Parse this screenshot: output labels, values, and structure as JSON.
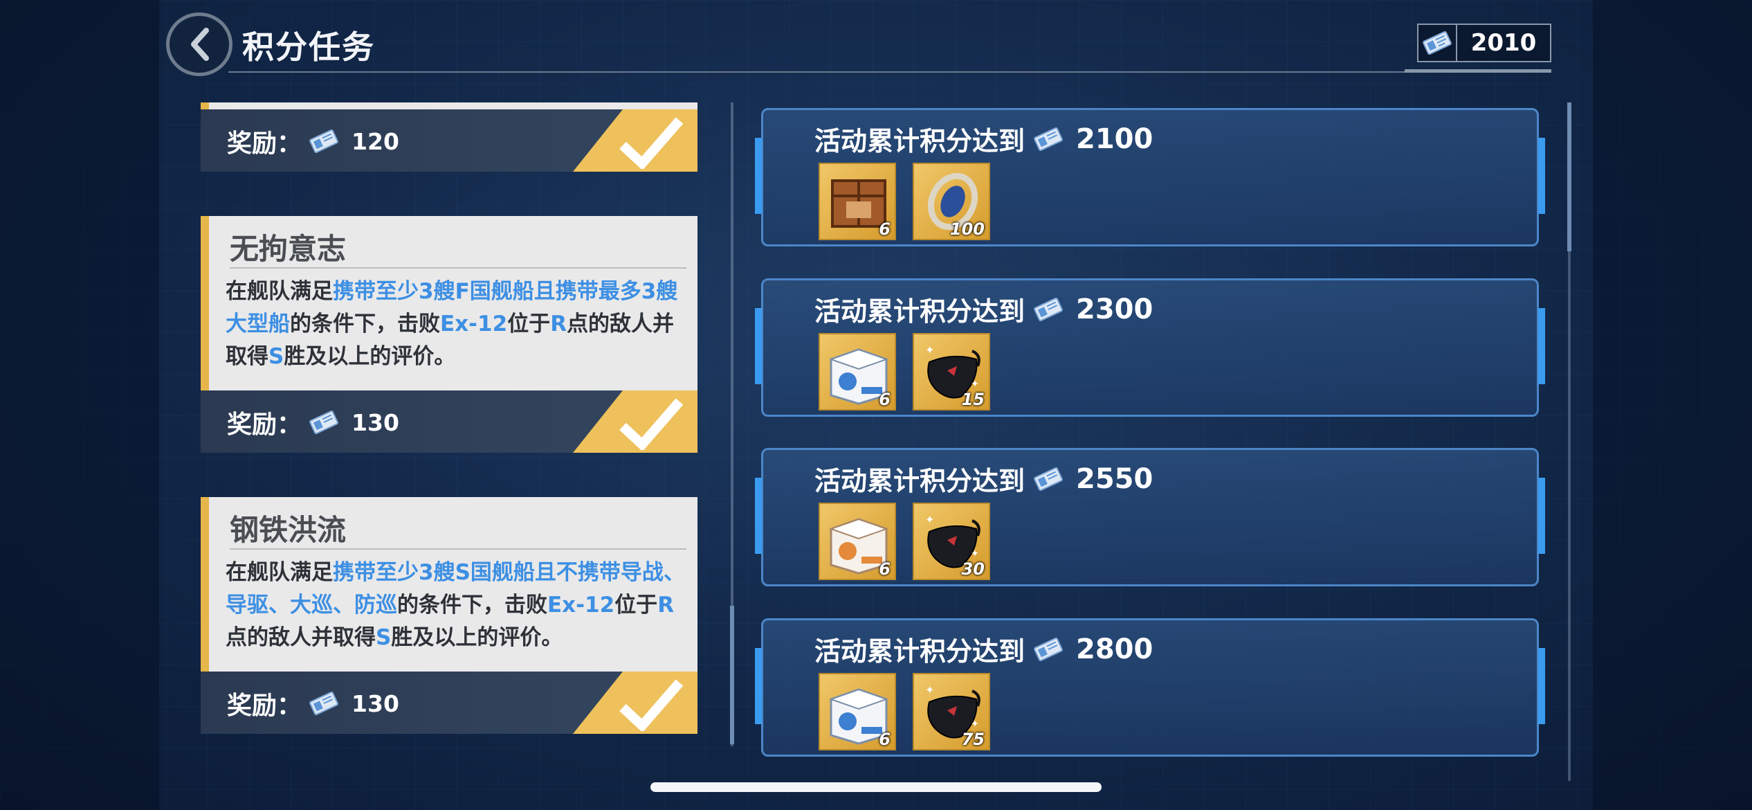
{
  "header": {
    "title": "积分任务",
    "points": "2010"
  },
  "tasks": [
    {
      "name": "",
      "reward_label": "奖励：",
      "reward_value": "120",
      "completed": true
    },
    {
      "name": "无拘意志",
      "desc_parts": [
        {
          "text": "在舰队满足",
          "hl": false
        },
        {
          "text": "携带至少3艘F国舰船且携带最多3艘大型船",
          "hl": true
        },
        {
          "text": "的条件下，击败",
          "hl": false
        },
        {
          "text": "Ex-12",
          "hl": true
        },
        {
          "text": "位于",
          "hl": false
        },
        {
          "text": "R",
          "hl": true
        },
        {
          "text": "点的敌人并取得",
          "hl": false
        },
        {
          "text": "S",
          "hl": true
        },
        {
          "text": "胜及以上的评价。",
          "hl": false
        }
      ],
      "reward_label": "奖励：",
      "reward_value": "130",
      "completed": true
    },
    {
      "name": "钢铁洪流",
      "desc_parts": [
        {
          "text": "在舰队满足",
          "hl": false
        },
        {
          "text": "携带至少3艘S国舰船且不携带导战、导驱、大巡、防巡",
          "hl": true
        },
        {
          "text": "的条件下，击败",
          "hl": false
        },
        {
          "text": "Ex-12",
          "hl": true
        },
        {
          "text": "位于",
          "hl": false
        },
        {
          "text": "R",
          "hl": true
        },
        {
          "text": "点的敌人并取得",
          "hl": false
        },
        {
          "text": "S",
          "hl": true
        },
        {
          "text": "胜及以上的评价。",
          "hl": false
        }
      ],
      "reward_label": "奖励：",
      "reward_value": "130",
      "completed": true
    }
  ],
  "milestones": [
    {
      "label": "活动累计积分达到",
      "target": "2100",
      "items": [
        {
          "icon": "wooden-crate-icon",
          "qty": "6"
        },
        {
          "icon": "ring-token-icon",
          "qty": "100"
        }
      ]
    },
    {
      "label": "活动累计积分达到",
      "target": "2300",
      "items": [
        {
          "icon": "blue-supply-box-icon",
          "qty": "6"
        },
        {
          "icon": "black-pouch-icon",
          "qty": "15"
        }
      ]
    },
    {
      "label": "活动累计积分达到",
      "target": "2550",
      "items": [
        {
          "icon": "orange-supply-box-icon",
          "qty": "6"
        },
        {
          "icon": "black-pouch-icon",
          "qty": "30"
        }
      ]
    },
    {
      "label": "活动累计积分达到",
      "target": "2800",
      "items": [
        {
          "icon": "blue-supply-box-icon",
          "qty": "6"
        },
        {
          "icon": "black-pouch-icon",
          "qty": "75"
        }
      ]
    }
  ],
  "colors": {
    "accent_gold": "#eec15c",
    "highlight_blue": "#3d8fe3",
    "card_border": "#4c86c8"
  }
}
